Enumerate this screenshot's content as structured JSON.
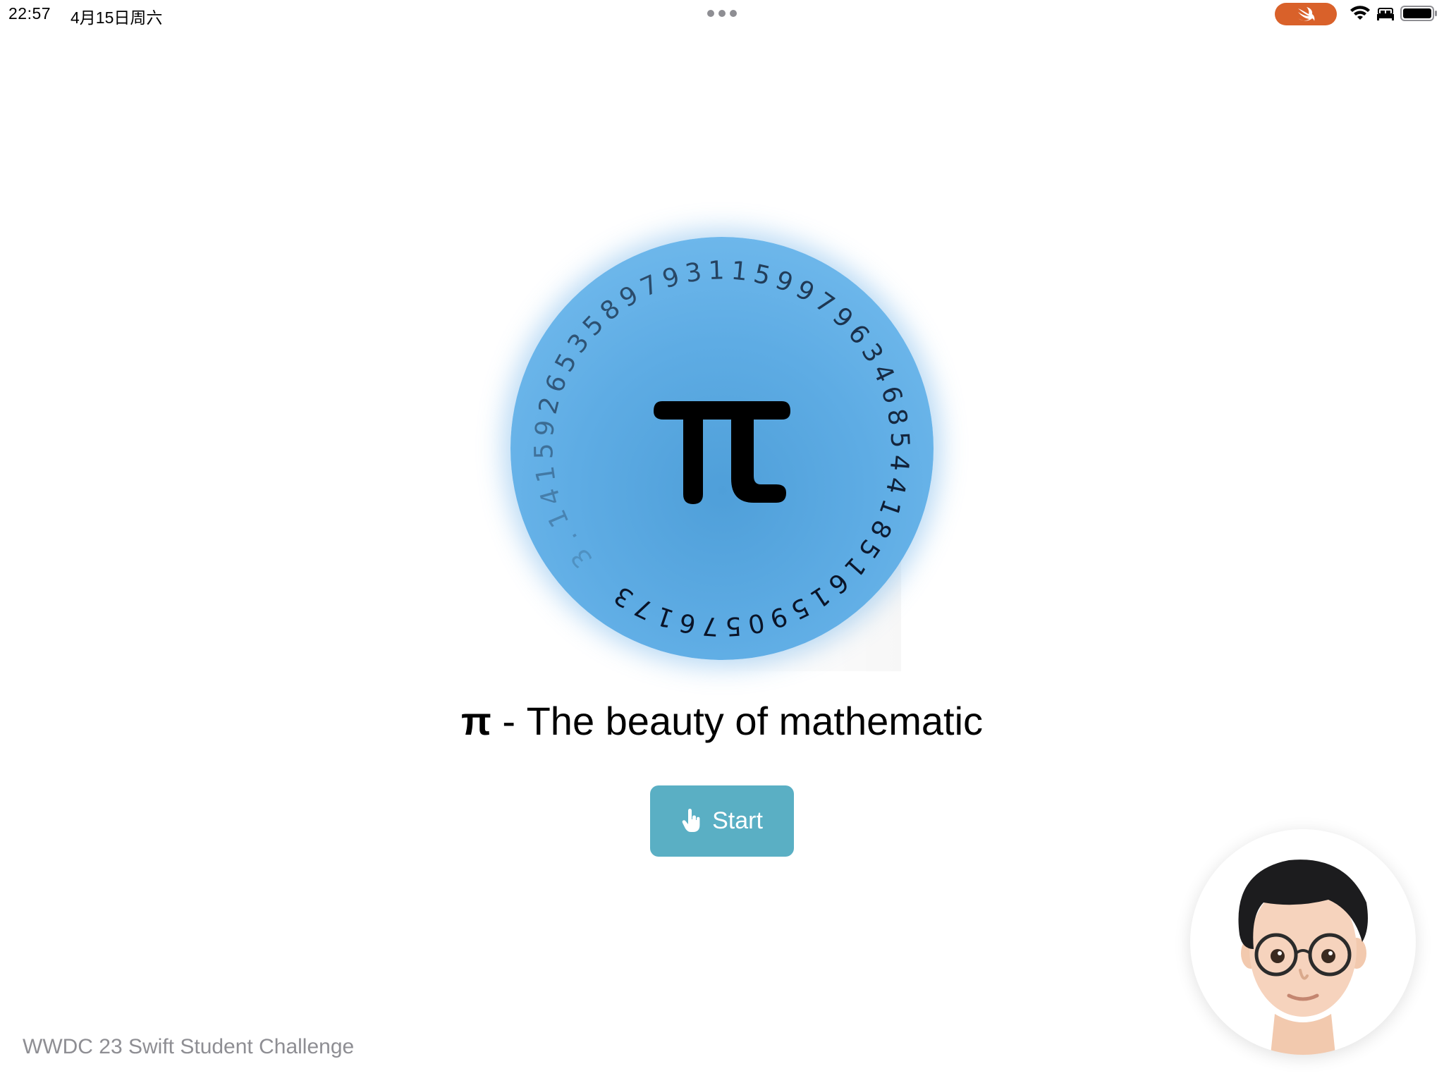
{
  "status_bar": {
    "time": "22:57",
    "date": "4月15日周六",
    "swift_pill_color": "#d9612a",
    "icons": [
      "swift-icon",
      "wifi-icon",
      "bed-icon",
      "battery-icon"
    ]
  },
  "disc": {
    "pi_symbol": "π",
    "digits": "3.141592653589793115997963468544185161590576173",
    "colors": {
      "inner": "#4f9fd9",
      "outer": "#78bff0"
    }
  },
  "title": {
    "pi": "π",
    "text": " - The beauty of mathematic"
  },
  "start_button": {
    "label": "Start",
    "icon": "hand-point-icon",
    "color": "#5aafc4"
  },
  "footer": {
    "text": "WWDC 23 Swift Student Challenge"
  },
  "avatar": {
    "icon": "memoji-avatar"
  }
}
